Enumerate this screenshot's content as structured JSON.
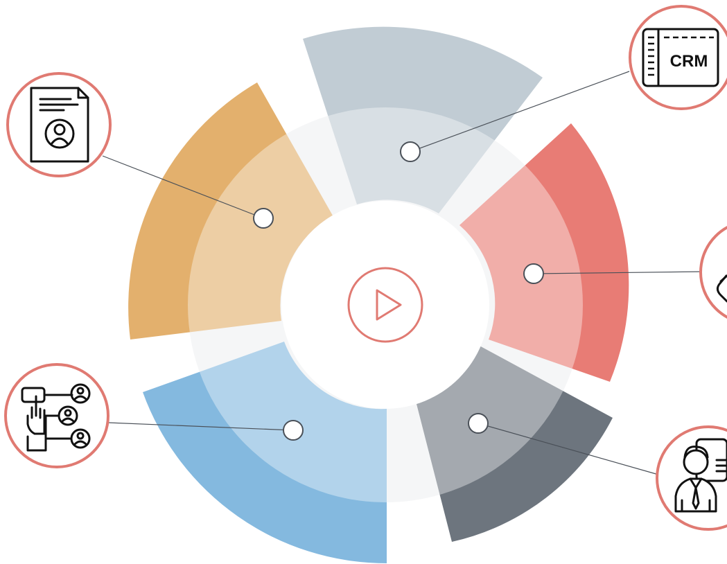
{
  "diagram": {
    "center_icon": "play-icon",
    "outline_color": "#e07a72",
    "inner_ring_color": "#eff0f2",
    "segments": [
      {
        "id": "crm",
        "color": "#c1ccd4",
        "icon": "crm-window-icon",
        "icon_text": "CRM"
      },
      {
        "id": "support",
        "color": "#e87c75",
        "icon": "handshake-icon"
      },
      {
        "id": "consultant",
        "color": "#6d757e",
        "icon": "presenter-icon"
      },
      {
        "id": "network",
        "color": "#84b9df",
        "icon": "user-network-icon"
      },
      {
        "id": "profile",
        "color": "#e3b06d",
        "icon": "profile-document-icon"
      }
    ]
  }
}
